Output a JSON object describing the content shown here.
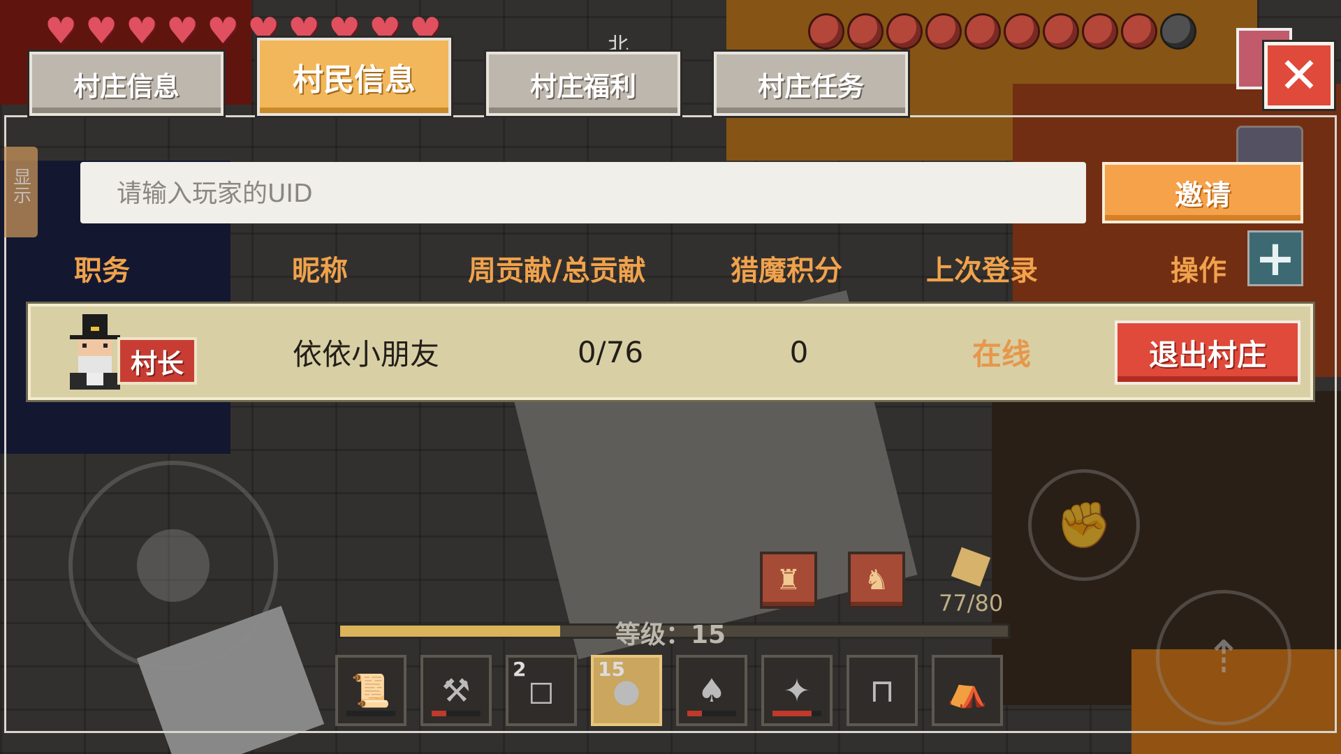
{
  "tabs": [
    {
      "label": "村庄信息"
    },
    {
      "label": "村民信息"
    },
    {
      "label": "村庄福利"
    },
    {
      "label": "村庄任务"
    }
  ],
  "active_tab": "村民信息",
  "compass": "北",
  "side_tab": {
    "label": "显示"
  },
  "search": {
    "placeholder": "请输入玩家的UID",
    "help_label": "?"
  },
  "invite_button": "邀请",
  "columns": {
    "role": "职务",
    "nickname": "昵称",
    "contribution": "周贡献/总贡献",
    "hunt_score": "猎魔积分",
    "last_login": "上次登录",
    "action": "操作"
  },
  "members": [
    {
      "role": "村长",
      "nickname": "依依小朋友",
      "contribution": "0/76",
      "hunt_score": "0",
      "last_login": "在线",
      "action_label": "退出村庄"
    }
  ],
  "hud": {
    "health_count": 10,
    "hunger_count": 10,
    "hunger_filled": 9,
    "level_text": "等级：15",
    "xp_progress": 0.33,
    "food_count": "77/80"
  },
  "hotbar": [
    {
      "icon": "scroll-icon",
      "count": "",
      "durability": 0
    },
    {
      "icon": "axe-icon",
      "count": "",
      "durability": 0.3
    },
    {
      "icon": "block-icon",
      "count": "2",
      "durability": null
    },
    {
      "icon": "fruit-icon",
      "count": "15",
      "durability": null
    },
    {
      "icon": "shovel-icon",
      "count": "",
      "durability": 0.3
    },
    {
      "icon": "staff-icon",
      "count": "",
      "durability": 0.8
    },
    {
      "icon": "sign-icon",
      "count": "",
      "durability": null
    },
    {
      "icon": "backpack-icon",
      "count": "",
      "durability": null
    }
  ],
  "selected_slot": 3,
  "colors": {
    "accent_orange": "#f2b75a",
    "column_header": "#f0a24c",
    "danger_red": "#e04a3a",
    "row_bg": "#d8cfa5",
    "status_online": "#e6974b"
  }
}
